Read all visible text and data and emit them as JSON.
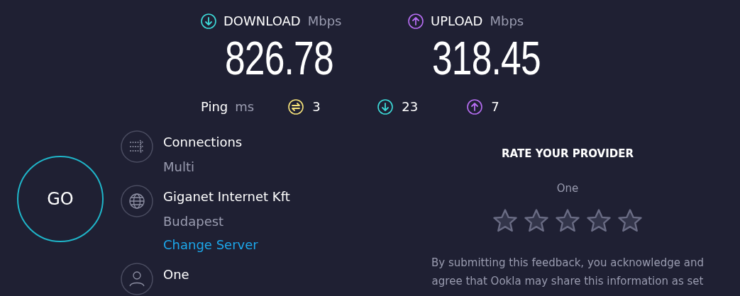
{
  "download": {
    "label": "DOWNLOAD",
    "unit": "Mbps",
    "value": "826.78"
  },
  "upload": {
    "label": "UPLOAD",
    "unit": "Mbps",
    "value": "318.45"
  },
  "ping": {
    "label": "Ping",
    "unit": "ms",
    "readings": [
      {
        "kind": "idle",
        "value": "3"
      },
      {
        "kind": "download",
        "value": "23"
      },
      {
        "kind": "upload",
        "value": "7"
      }
    ]
  },
  "go_button": "GO",
  "details": [
    {
      "kind": "connections",
      "title": "Connections",
      "subtitle": "Multi"
    },
    {
      "kind": "server",
      "title": "Giganet Internet Kft",
      "subtitle": "Budapest",
      "link": "Change Server"
    },
    {
      "kind": "user",
      "title": "One"
    }
  ],
  "rating": {
    "title": "RATE YOUR PROVIDER",
    "provider": "One",
    "stars": 0,
    "note": "By submitting this feedback, you acknowledge and agree that Ookla may share this information as set"
  }
}
